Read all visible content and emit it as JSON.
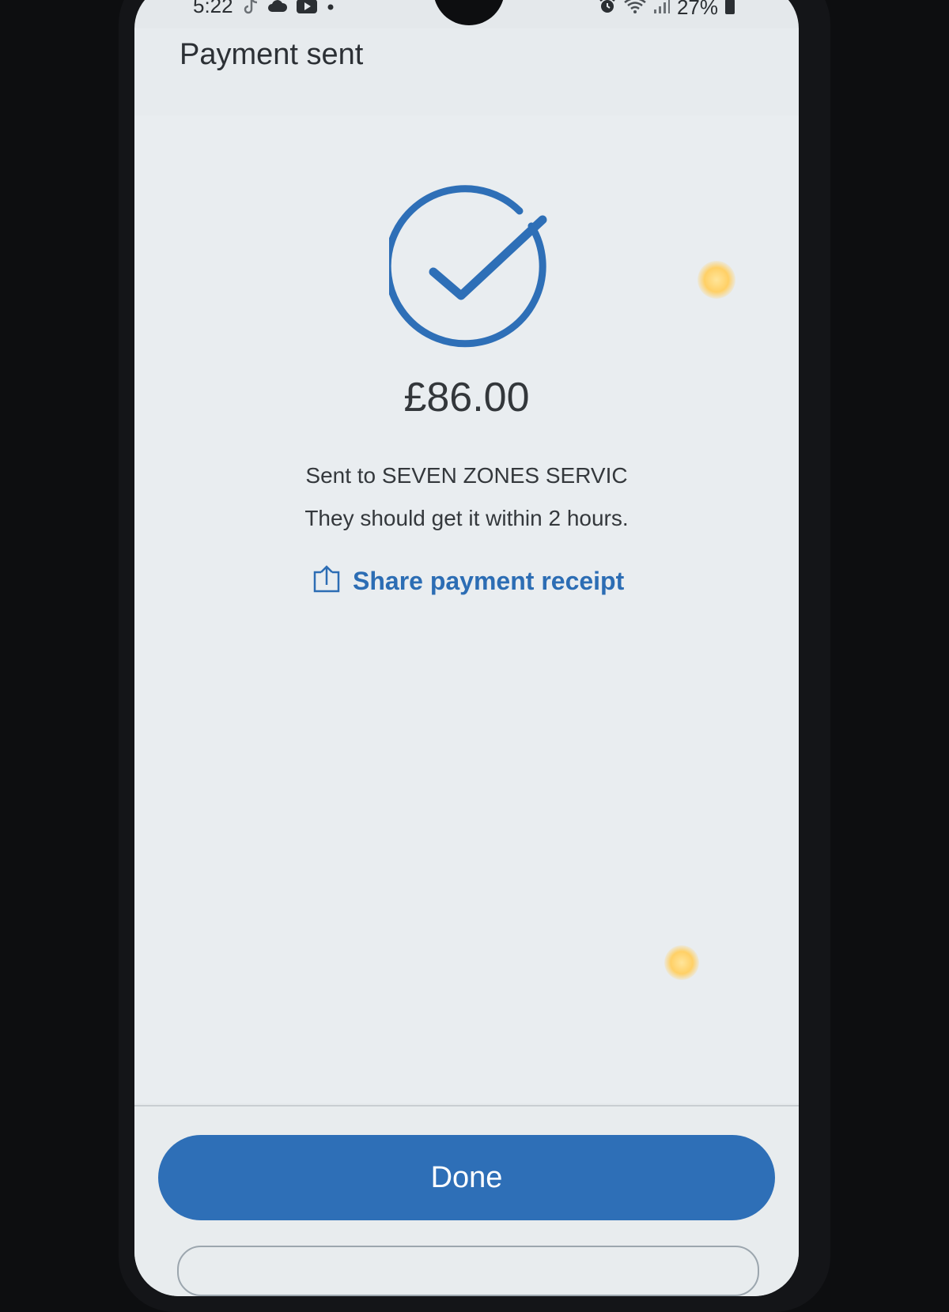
{
  "status_bar": {
    "time": "5:22",
    "left_icons": [
      "tiktok-icon",
      "cloud-icon",
      "youtube-icon",
      "dot-icon"
    ],
    "right_icons": [
      "alarm-icon",
      "wifi-icon",
      "signal-icon"
    ],
    "battery": "27%"
  },
  "header": {
    "title": "Payment sent"
  },
  "confirmation": {
    "icon": "check-circle-icon",
    "amount": "£86.00",
    "recipient_line": "Sent to SEVEN ZONES SERVIC",
    "eta_line": "They should get it within 2 hours.",
    "share_label": "Share payment receipt",
    "share_icon": "share-icon"
  },
  "footer": {
    "done_label": "Done"
  },
  "colors": {
    "accent": "#2e6fb7",
    "link": "#2c6db4",
    "text": "#33373b"
  }
}
